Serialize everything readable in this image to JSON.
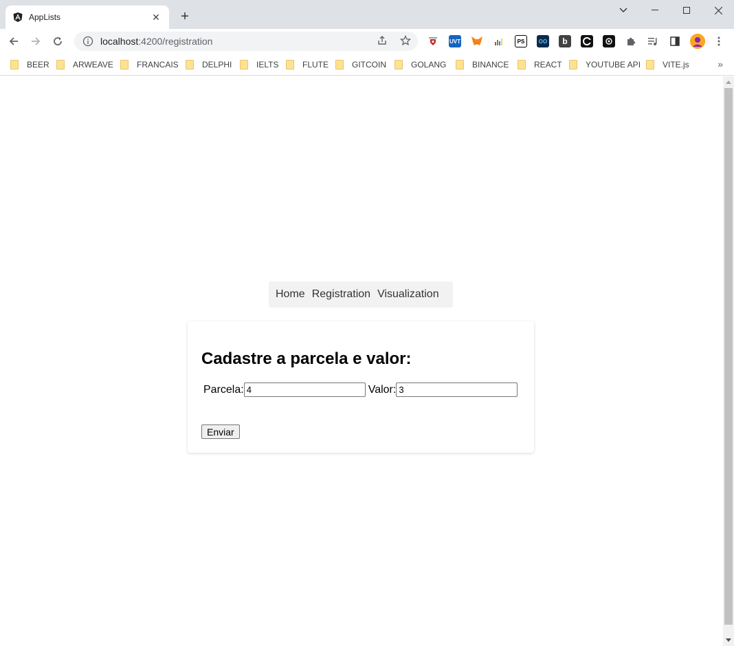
{
  "browser": {
    "tab": {
      "title": "AppLists"
    },
    "address": {
      "host": "localhost",
      "path": ":4200/registration"
    },
    "bookmarks": [
      "BEER",
      "ARWEAVE",
      "FRANCAIS",
      "DELPHI",
      "IELTS",
      "FLUTE",
      "GITCOIN",
      "GOLANG",
      "BINANCE",
      "REACT",
      "YOUTUBE API",
      "VITE.js"
    ],
    "bookmarks_more": "»"
  },
  "nav": {
    "home": "Home",
    "registration": "Registration",
    "visualization": "Visualization"
  },
  "form": {
    "heading": "Cadastre a parcela e valor:",
    "parcela_label": "Parcela:",
    "parcela_value": "4",
    "valor_label": "Valor:",
    "valor_value": "3",
    "submit_label": "Enviar"
  },
  "colors": {
    "tabstrip": "#dee1e6",
    "nav_bg": "#f2f2f2"
  }
}
